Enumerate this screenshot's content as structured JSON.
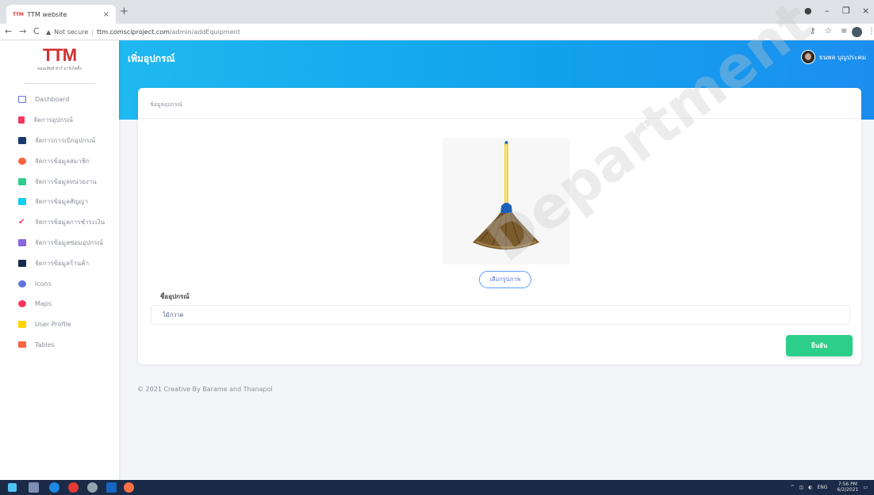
{
  "browser": {
    "tab_favicon": "TTM",
    "tab_title": "TTM website",
    "tab_close": "×",
    "new_tab": "+",
    "security_label": "Not secure",
    "url_host": "ttm.comsciproject.com",
    "url_path": "/admin/addEquipment",
    "nav": {
      "back": "←",
      "forward": "→",
      "reload": "C"
    },
    "window": {
      "minimize": "–",
      "maximize": "❐",
      "close": "×"
    }
  },
  "sidebar": {
    "logo_text": "TTM",
    "logo_sub": "คอมเพ้นท์ ทัวร์ มาร์เก็ตติ้ง",
    "items": [
      {
        "label": "Dashboard",
        "icon": "tv-icon",
        "color": "#5e72e4"
      },
      {
        "label": "จัดการอุปกรณ์",
        "icon": "equipment-icon",
        "color": "#f5365c"
      },
      {
        "label": "จัดการการเบิกอุปกรณ์",
        "icon": "folder-icon",
        "color": "#1a3a6e"
      },
      {
        "label": "จัดการข้อมูลสมาชิก",
        "icon": "user-icon",
        "color": "#fb6340"
      },
      {
        "label": "จัดการข้อมูลหน่วยงาน",
        "icon": "briefcase-icon",
        "color": "#2dce89"
      },
      {
        "label": "จัดการข้อมูลสัญญา",
        "icon": "contract-icon",
        "color": "#11cdef"
      },
      {
        "label": "จัดการข้อมูลการชำระเงิน",
        "icon": "check-icon",
        "color": "#f5365c"
      },
      {
        "label": "จัดการข้อมูลซ่อมอุปกรณ์",
        "icon": "tools-icon",
        "color": "#8965e0"
      },
      {
        "label": "จัดการข้อมูลร้านค้า",
        "icon": "shop-icon",
        "color": "#172b4d"
      },
      {
        "label": "Icons",
        "icon": "planet-icon",
        "color": "#5e72e4"
      },
      {
        "label": "Maps",
        "icon": "pin-icon",
        "color": "#f5365c"
      },
      {
        "label": "User Profile",
        "icon": "person-icon",
        "color": "#ffd600"
      },
      {
        "label": "Tables",
        "icon": "list-icon",
        "color": "#fb6340"
      }
    ]
  },
  "header": {
    "page_title": "เพิ่มอุปกรณ์",
    "user_name": "ธนพล บุญประคม"
  },
  "form": {
    "section_title": "ข้อมูลอุปกรณ์",
    "choose_image_label": "เลือกรูปภาพ",
    "name_label": "ชื่ออุปกรณ์",
    "name_value": "ไม้กวาด",
    "submit_label": "ยืนยัน"
  },
  "footer": {
    "text": "© 2021 Creative By Barame and Thanapol"
  },
  "watermark": "Department",
  "taskbar": {
    "language": "ENG",
    "time": "7:56 PM",
    "date": "6/2/2021"
  },
  "colors": {
    "header_gradient_start": "#1fb8f0",
    "header_gradient_end": "#1c8ef0",
    "accent": "#5e72e4",
    "success": "#2dce89"
  }
}
